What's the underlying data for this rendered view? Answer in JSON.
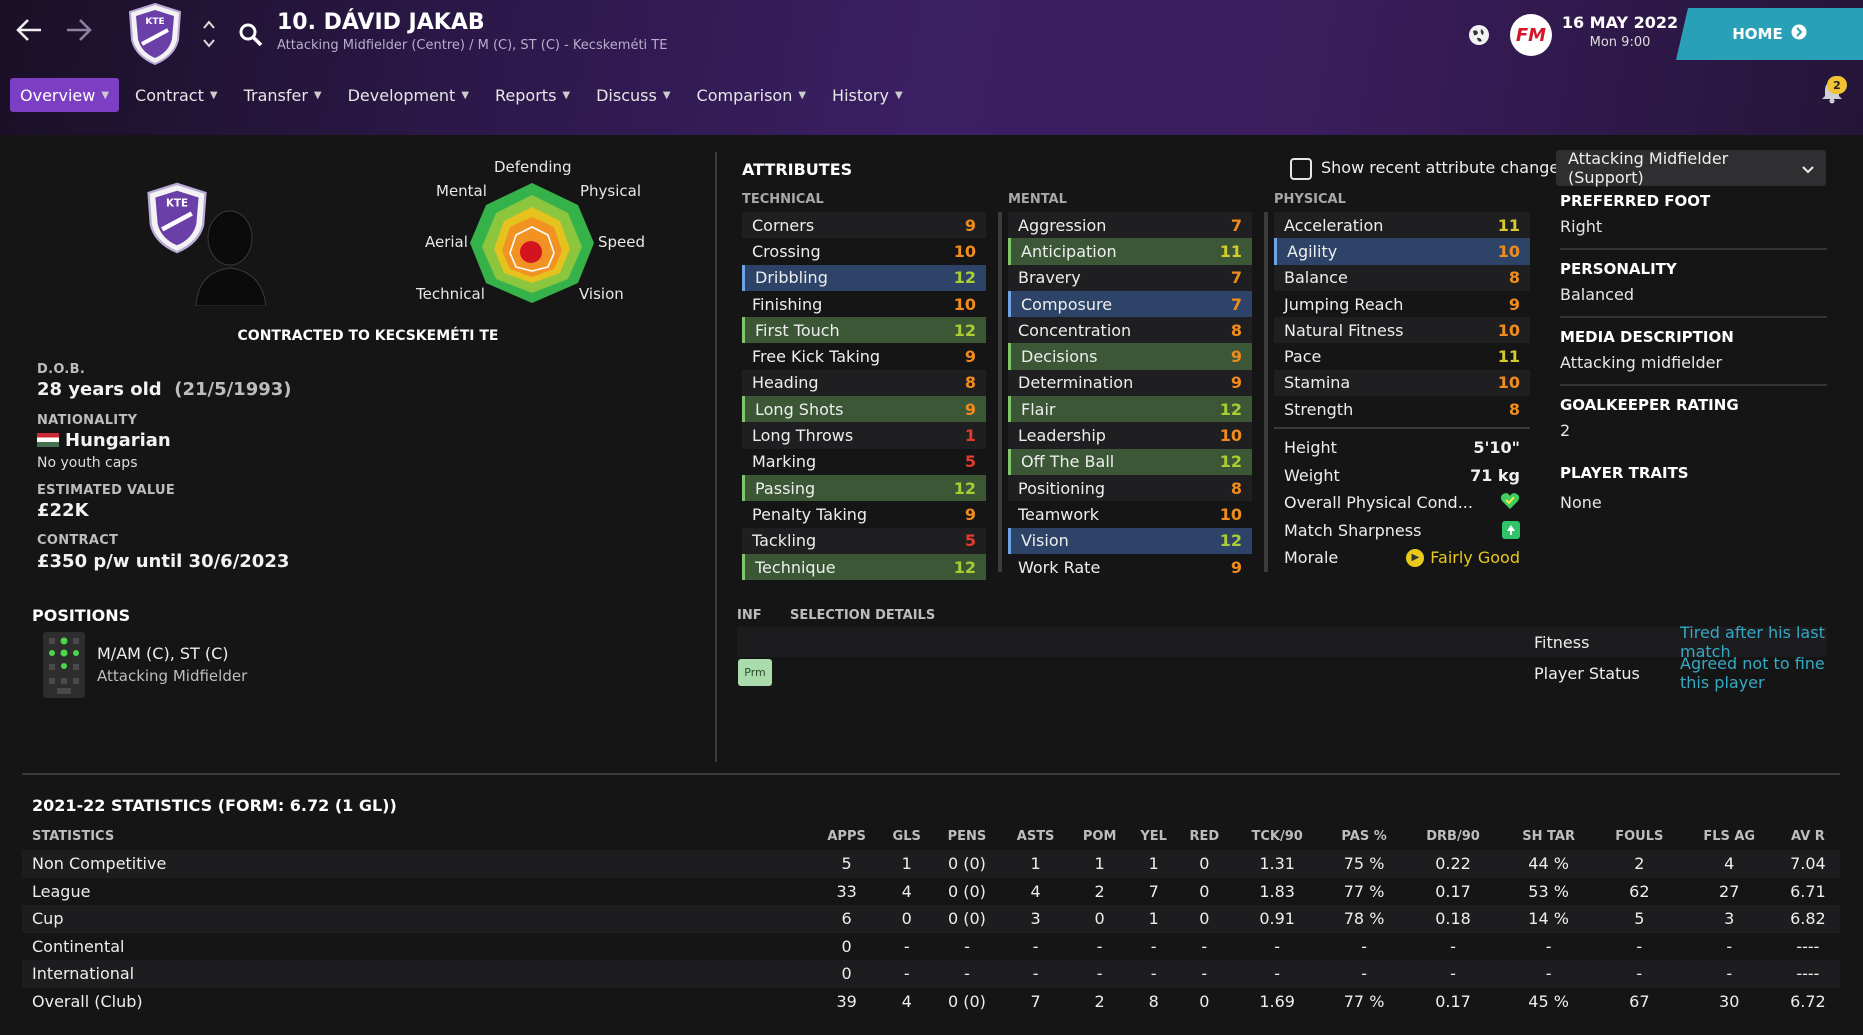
{
  "header": {
    "player_name": "10. DÁVID JAKAB",
    "player_subtitle": "Attacking Midfielder (Centre) / M (C), ST (C) - Kecskeméti TE",
    "club_abbr": "KTE",
    "date": "16 MAY 2022",
    "time": "Mon 9:00",
    "home_label": "HOME",
    "fm_logo": "FM",
    "notification_count": "2"
  },
  "menu": [
    {
      "label": "Overview",
      "active": true
    },
    {
      "label": "Contract"
    },
    {
      "label": "Transfer"
    },
    {
      "label": "Development"
    },
    {
      "label": "Reports"
    },
    {
      "label": "Discuss"
    },
    {
      "label": "Comparison"
    },
    {
      "label": "History"
    }
  ],
  "spider": {
    "labels": [
      "Defending",
      "Physical",
      "Speed",
      "Vision",
      "Technical",
      "Aerial",
      "Mental"
    ]
  },
  "profile": {
    "contracted": "CONTRACTED TO KECSKEMÉTI TE",
    "dob_label": "D.O.B.",
    "dob_age": "28 years old",
    "dob_date": "(21/5/1993)",
    "nationality_label": "NATIONALITY",
    "nationality": "Hungarian",
    "youth_caps": "No youth caps",
    "value_label": "ESTIMATED VALUE",
    "value": "£22K",
    "contract_label": "CONTRACT",
    "contract": "£350 p/w until 30/6/2023"
  },
  "positions": {
    "title": "POSITIONS",
    "main": "M/AM (C), ST (C)",
    "sub": "Attacking Midfielder"
  },
  "attributes": {
    "title": "ATTRIBUTES",
    "recent_changes_label": "Show recent attribute changes",
    "role": "Attacking Midfielder (Support)",
    "technical_label": "TECHNICAL",
    "mental_label": "MENTAL",
    "physical_label": "PHYSICAL",
    "technical": [
      {
        "name": "Corners",
        "value": "9",
        "hl": ""
      },
      {
        "name": "Crossing",
        "value": "10",
        "hl": ""
      },
      {
        "name": "Dribbling",
        "value": "12",
        "hl": "b"
      },
      {
        "name": "Finishing",
        "value": "10",
        "hl": ""
      },
      {
        "name": "First Touch",
        "value": "12",
        "hl": "g"
      },
      {
        "name": "Free Kick Taking",
        "value": "9",
        "hl": ""
      },
      {
        "name": "Heading",
        "value": "8",
        "hl": ""
      },
      {
        "name": "Long Shots",
        "value": "9",
        "hl": "g"
      },
      {
        "name": "Long Throws",
        "value": "1",
        "hl": ""
      },
      {
        "name": "Marking",
        "value": "5",
        "hl": ""
      },
      {
        "name": "Passing",
        "value": "12",
        "hl": "g"
      },
      {
        "name": "Penalty Taking",
        "value": "9",
        "hl": ""
      },
      {
        "name": "Tackling",
        "value": "5",
        "hl": ""
      },
      {
        "name": "Technique",
        "value": "12",
        "hl": "g"
      }
    ],
    "mental": [
      {
        "name": "Aggression",
        "value": "7",
        "hl": ""
      },
      {
        "name": "Anticipation",
        "value": "11",
        "hl": "g"
      },
      {
        "name": "Bravery",
        "value": "7",
        "hl": ""
      },
      {
        "name": "Composure",
        "value": "7",
        "hl": "b"
      },
      {
        "name": "Concentration",
        "value": "8",
        "hl": ""
      },
      {
        "name": "Decisions",
        "value": "9",
        "hl": "g"
      },
      {
        "name": "Determination",
        "value": "9",
        "hl": ""
      },
      {
        "name": "Flair",
        "value": "12",
        "hl": "g"
      },
      {
        "name": "Leadership",
        "value": "10",
        "hl": ""
      },
      {
        "name": "Off The Ball",
        "value": "12",
        "hl": "g"
      },
      {
        "name": "Positioning",
        "value": "8",
        "hl": ""
      },
      {
        "name": "Teamwork",
        "value": "10",
        "hl": ""
      },
      {
        "name": "Vision",
        "value": "12",
        "hl": "b"
      },
      {
        "name": "Work Rate",
        "value": "9",
        "hl": ""
      }
    ],
    "physical": [
      {
        "name": "Acceleration",
        "value": "11",
        "hl": ""
      },
      {
        "name": "Agility",
        "value": "10",
        "hl": "b"
      },
      {
        "name": "Balance",
        "value": "8",
        "hl": ""
      },
      {
        "name": "Jumping Reach",
        "value": "9",
        "hl": ""
      },
      {
        "name": "Natural Fitness",
        "value": "10",
        "hl": ""
      },
      {
        "name": "Pace",
        "value": "11",
        "hl": ""
      },
      {
        "name": "Stamina",
        "value": "10",
        "hl": ""
      },
      {
        "name": "Strength",
        "value": "8",
        "hl": ""
      }
    ],
    "physical_extra": {
      "height_label": "Height",
      "height": "5'10\"",
      "weight_label": "Weight",
      "weight": "71 kg",
      "condition_label": "Overall Physical Cond...",
      "sharpness_label": "Match Sharpness",
      "morale_label": "Morale",
      "morale": "Fairly Good"
    }
  },
  "side_info": {
    "foot_label": "PREFERRED FOOT",
    "foot": "Right",
    "personality_label": "PERSONALITY",
    "personality": "Balanced",
    "media_label": "MEDIA DESCRIPTION",
    "media": "Attacking midfielder",
    "gk_label": "GOALKEEPER RATING",
    "gk": "2",
    "traits_label": "PLAYER TRAITS",
    "traits": "None"
  },
  "selection": {
    "inf_label": "INF",
    "title": "SELECTION DETAILS",
    "rows": [
      {
        "badge": "",
        "label": "Fitness",
        "value": "Tired after his last match"
      },
      {
        "badge": "Prm",
        "label": "Player Status",
        "value": "Agreed not to fine this player"
      }
    ]
  },
  "stats": {
    "title": "2021-22 STATISTICS (FORM: 6.72 (1 GL))",
    "columns": [
      "STATISTICS",
      "APPS",
      "GLS",
      "PENS",
      "ASTS",
      "POM",
      "YEL",
      "RED",
      "TCK/90",
      "PAS %",
      "DRB/90",
      "SH TAR",
      "FOULS",
      "FLS AG",
      "AV R"
    ],
    "rows": [
      [
        "Non Competitive",
        "5",
        "1",
        "0 (0)",
        "1",
        "1",
        "1",
        "0",
        "1.31",
        "75 %",
        "0.22",
        "44 %",
        "2",
        "4",
        "7.04"
      ],
      [
        "League",
        "33",
        "4",
        "0 (0)",
        "4",
        "2",
        "7",
        "0",
        "1.83",
        "77 %",
        "0.17",
        "53 %",
        "62",
        "27",
        "6.71"
      ],
      [
        "Cup",
        "6",
        "0",
        "0 (0)",
        "3",
        "0",
        "1",
        "0",
        "0.91",
        "78 %",
        "0.18",
        "14 %",
        "5",
        "3",
        "6.82"
      ],
      [
        "Continental",
        "0",
        "-",
        "-",
        "-",
        "-",
        "-",
        "-",
        "-",
        "-",
        "-",
        "-",
        "-",
        "-",
        "----"
      ],
      [
        "International",
        "0",
        "-",
        "-",
        "-",
        "-",
        "-",
        "-",
        "-",
        "-",
        "-",
        "-",
        "-",
        "-",
        "----"
      ],
      [
        "Overall (Club)",
        "39",
        "4",
        "0 (0)",
        "7",
        "2",
        "8",
        "0",
        "1.69",
        "77 %",
        "0.17",
        "45 %",
        "67",
        "30",
        "6.72"
      ]
    ]
  }
}
